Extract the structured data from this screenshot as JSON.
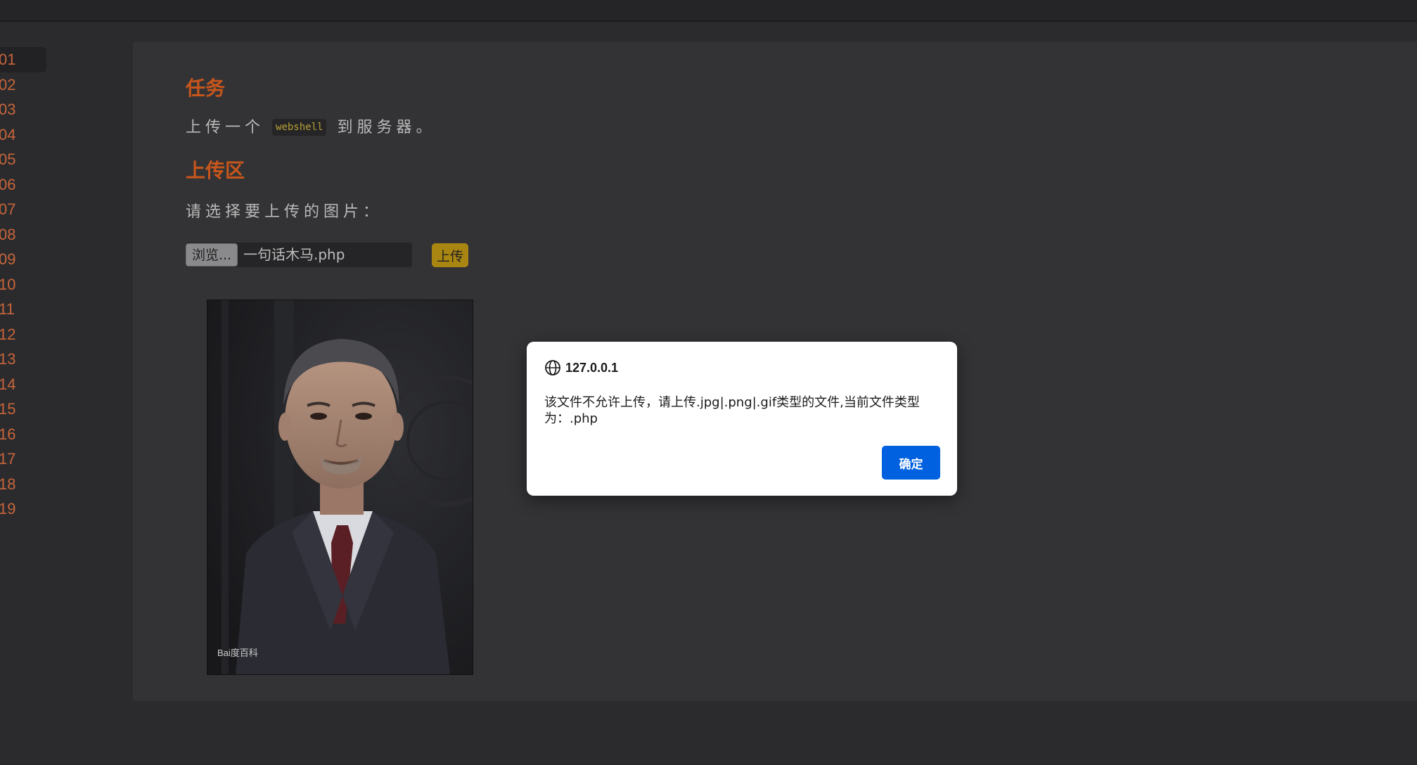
{
  "sidebar": {
    "passes": [
      "01",
      "02",
      "03",
      "04",
      "05",
      "06",
      "07",
      "08",
      "09",
      "10",
      "11",
      "12",
      "13",
      "14",
      "15",
      "16",
      "17",
      "18",
      "19"
    ],
    "active_index": 0
  },
  "task": {
    "heading": "任务",
    "text_before": "上传一个",
    "code": "webshell",
    "text_after": "到服务器。"
  },
  "upload": {
    "heading": "上传区",
    "prompt": "请选择要上传的图片：",
    "browse_label": "浏览...",
    "file_name": "一句话木马.php",
    "submit_label": "上传",
    "image_watermark": "Bai度百科"
  },
  "dialog": {
    "origin": "127.0.0.1",
    "message": "该文件不允许上传，请上传.jpg|.png|.gif类型的文件,当前文件类型为：.php",
    "ok_label": "确定",
    "ok_color": "#0061e0"
  },
  "colors": {
    "heading": "#c7561c",
    "pass_number": "#c7653a",
    "upload_button": "#a98612",
    "panel": "#333336",
    "background": "#2b2b2e"
  }
}
